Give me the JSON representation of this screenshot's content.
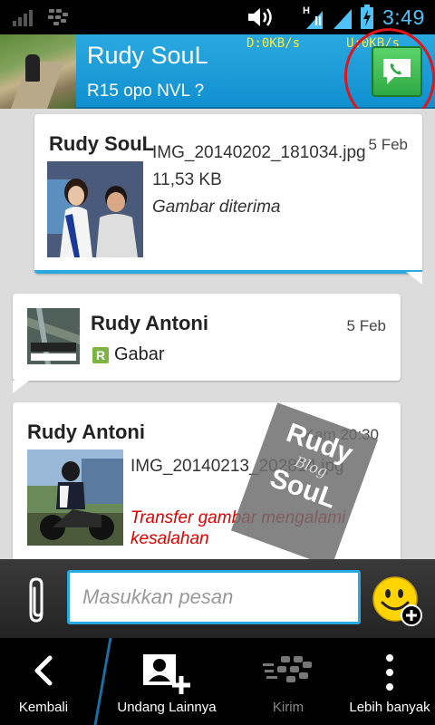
{
  "status_bar": {
    "time": "3:49",
    "network_type": "H",
    "icons": [
      "signal-icon",
      "bbm-icon",
      "volume-icon",
      "hspa-icon",
      "signal-icon",
      "battery-charging-icon"
    ]
  },
  "header": {
    "contact_name": "Rudy SouL",
    "contact_status": "R15 opo NVL ?",
    "net_down": "D:0KB/s",
    "net_up": "U:0KB/s",
    "call_icon": "phone-call-icon",
    "accent_color": "#2aa8e0"
  },
  "messages": [
    {
      "sender": "Rudy SouL",
      "date": "5 Feb",
      "filename": "IMG_20140202_181034.jpg",
      "filesize": "11,53 KB",
      "status": "Gambar diterima"
    },
    {
      "sender": "Rudy Antoni",
      "date": "5 Feb",
      "sticker_badge": "R",
      "text": "Gabar"
    },
    {
      "sender": "Rudy Antoni",
      "date": "Kam 20:30",
      "filename": "IMG_20140213_202814.jpg",
      "status": "Transfer gambar mengalami kesalahan"
    }
  ],
  "watermark": {
    "line1": "Rudy",
    "line2": "Blog",
    "line3": "SouL"
  },
  "composer": {
    "placeholder": "Masukkan pesan",
    "attach_icon": "paperclip-icon",
    "emoji_icon": "smiley-add-icon"
  },
  "action_bar": {
    "back_label": "Kembali",
    "invite_label": "Undang Lainnya",
    "send_label": "Kirim",
    "more_label": "Lebih banyak"
  }
}
